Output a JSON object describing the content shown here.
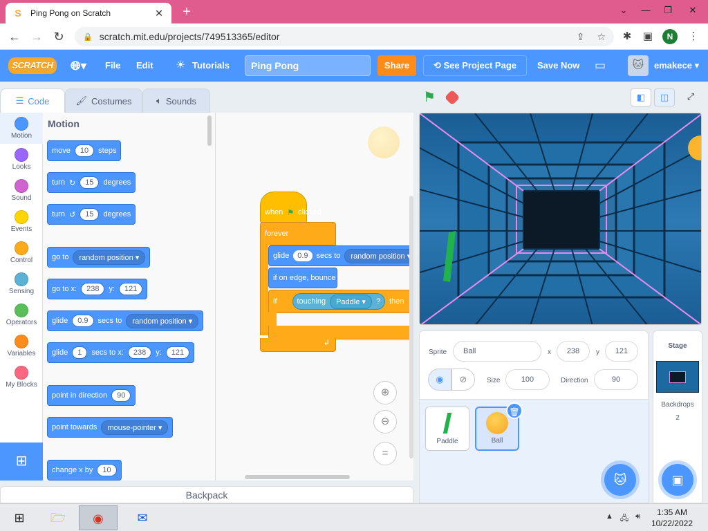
{
  "browser": {
    "tab_title": "Ping Pong on Scratch",
    "tab_favicon": "scratch-cat-icon",
    "url": "scratch.mit.edu/projects/749513365/editor",
    "profile_initial": "N"
  },
  "menubar": {
    "logo": "SCRATCH",
    "file": "File",
    "edit": "Edit",
    "tutorials": "Tutorials",
    "project_title": "Ping Pong",
    "share": "Share",
    "see_project_page": "See Project Page",
    "save_now": "Save Now",
    "username": "emakece"
  },
  "tabs": {
    "code": "Code",
    "costumes": "Costumes",
    "sounds": "Sounds"
  },
  "categories": [
    {
      "label": "Motion",
      "color": "#4c97ff"
    },
    {
      "label": "Looks",
      "color": "#9966ff"
    },
    {
      "label": "Sound",
      "color": "#cf63cf"
    },
    {
      "label": "Events",
      "color": "#ffd500"
    },
    {
      "label": "Control",
      "color": "#ffab19"
    },
    {
      "label": "Sensing",
      "color": "#5cb1d6"
    },
    {
      "label": "Operators",
      "color": "#59c059"
    },
    {
      "label": "Variables",
      "color": "#ff8c1a"
    },
    {
      "label": "My Blocks",
      "color": "#ff6680"
    }
  ],
  "palette": {
    "heading": "Motion",
    "move": {
      "a": "move",
      "n": "10",
      "b": "steps"
    },
    "turn_right": {
      "a": "turn",
      "n": "15",
      "b": "degrees"
    },
    "turn_left": {
      "a": "turn",
      "n": "15",
      "b": "degrees"
    },
    "goto": {
      "a": "go to",
      "dd": "random position"
    },
    "goto_xy": {
      "a": "go to x:",
      "x": "238",
      "b": "y:",
      "y": "121"
    },
    "glide": {
      "a": "glide",
      "n": "0.9",
      "b": "secs to",
      "dd": "random position"
    },
    "glide_xy": {
      "a": "glide",
      "n": "1",
      "b": "secs to x:",
      "x": "238",
      "c": "y:",
      "y": "121"
    },
    "point_dir": {
      "a": "point in direction",
      "n": "90"
    },
    "point_towards": {
      "a": "point towards",
      "dd": "mouse-pointer"
    },
    "change_x": {
      "a": "change x by",
      "n": "10"
    }
  },
  "script": {
    "when": "when",
    "clicked": "clicked",
    "forever": "forever",
    "glide": "glide",
    "glide_secs": "0.9",
    "secs_to": "secs to",
    "glide_target": "random position",
    "bounce": "if on edge, bounce",
    "if": "if",
    "touching": "touching",
    "touching_target": "Paddle",
    "q": "?",
    "then": "then"
  },
  "sprite_info": {
    "sprite_label": "Sprite",
    "sprite_name": "Ball",
    "x_label": "x",
    "x": "238",
    "y_label": "y",
    "y": "121",
    "size_label": "Size",
    "size": "100",
    "direction_label": "Direction",
    "direction": "90"
  },
  "sprites": [
    {
      "name": "Paddle"
    },
    {
      "name": "Ball"
    }
  ],
  "stage_panel": {
    "title": "Stage",
    "backdrops_label": "Backdrops",
    "backdrops_count": "2"
  },
  "backpack": "Backpack",
  "taskbar": {
    "time": "1:35 AM",
    "date": "10/22/2022"
  }
}
